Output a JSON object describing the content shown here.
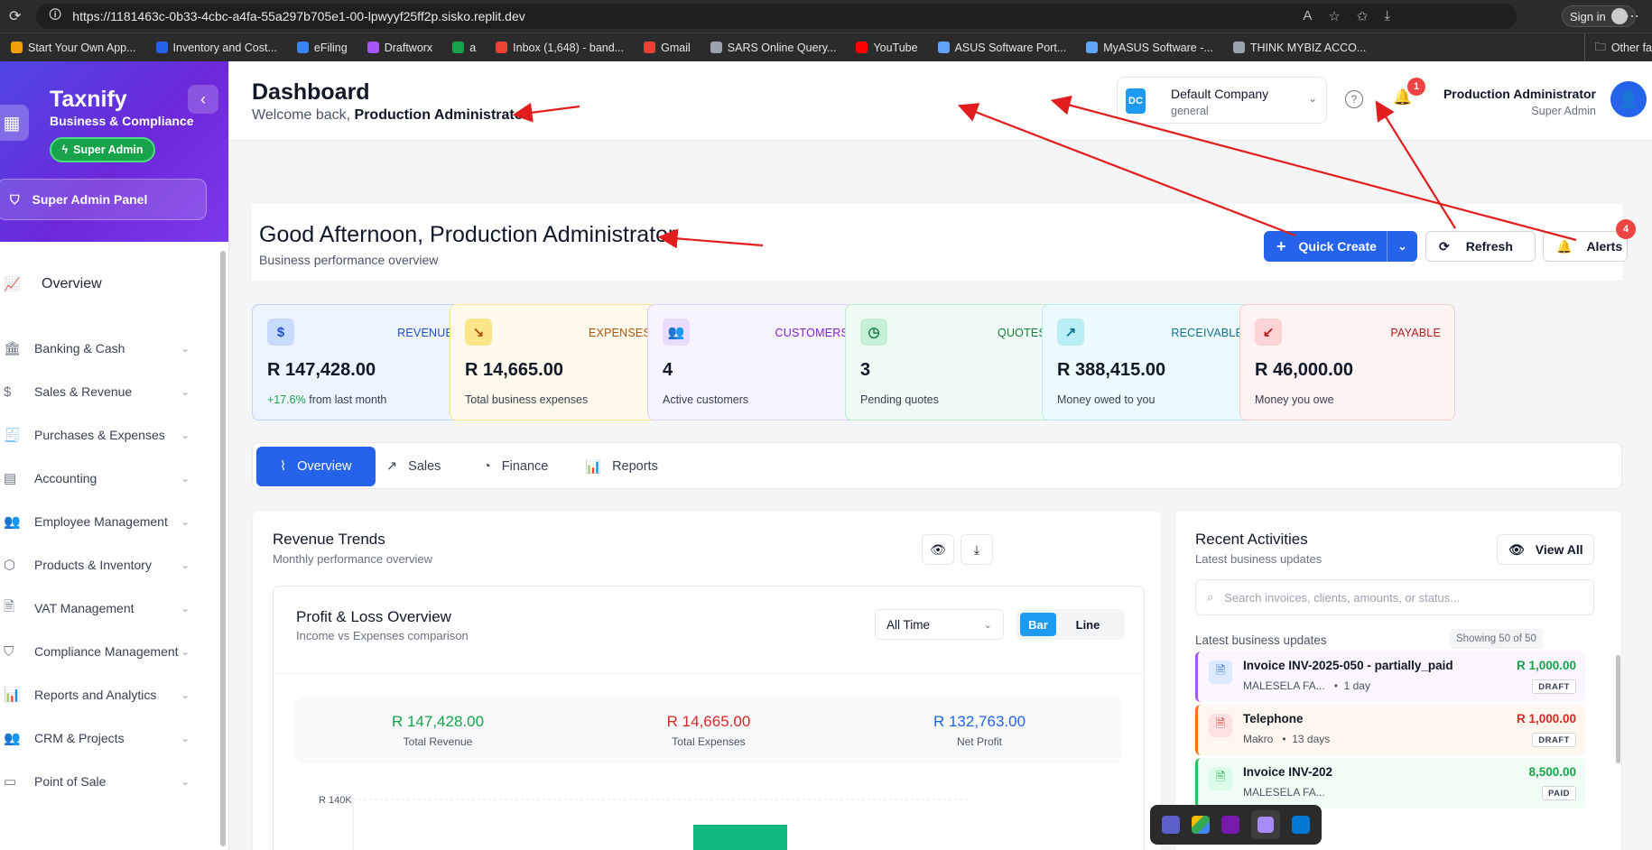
{
  "browser": {
    "url": "https://1181463c-0b33-4cbc-a4fa-55a297b705e1-00-lpwyyf25ff2p.sisko.replit.dev",
    "signin_label": "Sign in",
    "bookmarks": [
      {
        "label": "Start Your Own App...",
        "color": "#f59e0b"
      },
      {
        "label": "Inventory and Cost...",
        "color": "#2563eb"
      },
      {
        "label": "eFiling",
        "color": "#3b82f6"
      },
      {
        "label": "Draftworx",
        "color": "#a855f7"
      },
      {
        "label": "a",
        "color": "#16a34a"
      },
      {
        "label": "Inbox (1,648) - band...",
        "color": "#ea4335"
      },
      {
        "label": "Gmail",
        "color": "#ea4335"
      },
      {
        "label": "SARS Online Query...",
        "color": "#9ca3af"
      },
      {
        "label": "YouTube",
        "color": "#ff0000"
      },
      {
        "label": "ASUS Software Port...",
        "color": "#60a5fa"
      },
      {
        "label": "MyASUS Software -...",
        "color": "#60a5fa"
      },
      {
        "label": "THINK MYBIZ ACCO...",
        "color": "#9ca3af"
      }
    ],
    "other_favorites": "Other fa"
  },
  "sidebar": {
    "brand_title": "Taxnify",
    "brand_subtitle": "Business & Compliance",
    "role_badge": "Super Admin",
    "super_panel": "Super Admin Panel",
    "overview": "Overview",
    "items": [
      {
        "label": "Banking & Cash",
        "icon": "bank-icon"
      },
      {
        "label": "Sales & Revenue",
        "icon": "dollar-icon"
      },
      {
        "label": "Purchases & Expenses",
        "icon": "receipt-icon"
      },
      {
        "label": "Accounting",
        "icon": "ledger-icon"
      },
      {
        "label": "Employee Management",
        "icon": "users-icon"
      },
      {
        "label": "Products & Inventory",
        "icon": "box-icon"
      },
      {
        "label": "VAT Management",
        "icon": "file-icon"
      },
      {
        "label": "Compliance Management",
        "icon": "shield-icon"
      },
      {
        "label": "Reports and Analytics",
        "icon": "bar-chart-icon"
      },
      {
        "label": "CRM & Projects",
        "icon": "users-icon"
      },
      {
        "label": "Point of Sale",
        "icon": "pos-icon"
      }
    ]
  },
  "header": {
    "title": "Dashboard",
    "welcome_prefix": "Welcome back, ",
    "welcome_name": "Production Administrator",
    "company_logo": "DC",
    "company_name": "Default Company",
    "company_type": "general",
    "notification_count": "1",
    "user_name": "Production Administrator",
    "user_role": "Super Admin"
  },
  "hero": {
    "greeting": "Good Afternoon, Production Administrator",
    "subtitle": "Business performance overview",
    "quick_create": "Quick Create",
    "refresh": "Refresh",
    "alerts": "Alerts",
    "alerts_count": "4"
  },
  "stats": [
    {
      "label": "REVENUE",
      "value": "R 147,428.00",
      "pct": "+17.6%",
      "sub": " from last month",
      "icon": "$",
      "bg": "#eef4ff",
      "border": "#bfd3fb",
      "accent": "#1d4ed8",
      "icon_bg": "#c7dbff"
    },
    {
      "label": "EXPENSES",
      "value": "R 14,665.00",
      "pct": "",
      "sub": "Total business expenses",
      "icon": "↘",
      "bg": "#fffaeb",
      "border": "#fde68a",
      "accent": "#b45309",
      "icon_bg": "#fde68a"
    },
    {
      "label": "CUSTOMERS",
      "value": "4",
      "pct": "",
      "sub": "Active customers",
      "icon": "👥",
      "bg": "#f7f3ff",
      "border": "#ddd0fb",
      "accent": "#7e22ce",
      "icon_bg": "#e9dcff"
    },
    {
      "label": "QUOTES",
      "value": "3",
      "pct": "",
      "sub": "Pending quotes",
      "icon": "◷",
      "bg": "#effbf4",
      "border": "#b9ecce",
      "accent": "#15803d",
      "icon_bg": "#c6f0d6"
    },
    {
      "label": "RECEIVABLE",
      "value": "R 388,415.00",
      "pct": "",
      "sub": "Money owed to you",
      "icon": "↗",
      "bg": "#ecfbfe",
      "border": "#b3ecf5",
      "accent": "#0e7490",
      "icon_bg": "#b9eef7"
    },
    {
      "label": "PAYABLE",
      "value": "R 46,000.00",
      "pct": "",
      "sub": "Money you owe",
      "icon": "↙",
      "bg": "#fff2f2",
      "border": "#fbcaca",
      "accent": "#b91c1c",
      "icon_bg": "#fdd4d4"
    }
  ],
  "tabs": [
    {
      "label": "Overview",
      "icon": "activity-icon"
    },
    {
      "label": "Sales",
      "icon": "trending-up-icon"
    },
    {
      "label": "Finance",
      "icon": "pie-chart-icon"
    },
    {
      "label": "Reports",
      "icon": "bar-chart-icon"
    }
  ],
  "revenue": {
    "title": "Revenue Trends",
    "subtitle": "Monthly performance overview",
    "pl_title": "Profit & Loss Overview",
    "pl_subtitle": "Income vs Expenses comparison",
    "period": "All Time",
    "bar_label": "Bar",
    "line_label": "Line",
    "total_revenue": "R 147,428.00",
    "total_revenue_label": "Total Revenue",
    "total_expenses": "R 14,665.00",
    "total_expenses_label": "Total Expenses",
    "net_profit": "R 132,763.00",
    "net_profit_label": "Net Profit",
    "y_tick": "R 140K"
  },
  "activities": {
    "title": "Recent Activities",
    "subtitle": "Latest business updates",
    "view_all": "View All",
    "search_placeholder": "Search invoices, clients, amounts, or status...",
    "latest_label": "Latest business updates",
    "showing": "Showing 50 of 50",
    "items": [
      {
        "title": "Invoice INV-2025-050 - partially_paid",
        "party": "MALESELA FA...",
        "time": "1 day",
        "amount": "R 1,000.00",
        "status": "DRAFT",
        "amount_color": "#16a34a",
        "border": "#a855f7",
        "bg": "#faf5ff",
        "icon_bg": "#dbeafe",
        "icon_color": "#2563eb"
      },
      {
        "title": "Telephone",
        "party": "Makro",
        "time": "13 days",
        "amount": "R 1,000.00",
        "status": "DRAFT",
        "amount_color": "#dc2626",
        "border": "#f97316",
        "bg": "#fff7ed",
        "icon_bg": "#fee2e2",
        "icon_color": "#dc2626"
      },
      {
        "title": "Invoice INV-202",
        "party": "MALESELA FA...",
        "time": "",
        "amount": "8,500.00",
        "status": "PAID",
        "amount_color": "#16a34a",
        "border": "#22c55e",
        "bg": "#f0fdf4",
        "icon_bg": "#dcfce7",
        "icon_color": "#16a34a"
      }
    ]
  }
}
